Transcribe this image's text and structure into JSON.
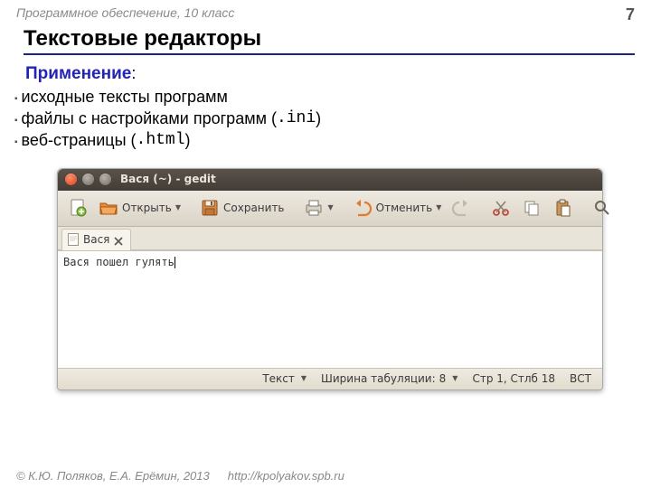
{
  "header": {
    "course": "Программное обеспечение, 10 класс",
    "page": "7"
  },
  "title": "Текстовые редакторы",
  "content": {
    "subhead": "Применение",
    "colon": ":",
    "bullets": [
      {
        "text": "исходные тексты программ",
        "suffix": ""
      },
      {
        "text": "файлы с настройками программ (",
        "mono": ".ini",
        "suffix": ")"
      },
      {
        "text": "веб-страницы (",
        "mono": ".html",
        "suffix": ")"
      }
    ]
  },
  "gedit": {
    "window_title": "Вася (~) - gedit",
    "toolbar": {
      "open": "Открыть",
      "save": "Сохранить",
      "undo": "Отменить"
    },
    "tab": {
      "name": "Вася"
    },
    "editor_text": "Вася пошел гулять",
    "status": {
      "syntax": "Текст",
      "tabwidth_label": "Ширина табуляции:",
      "tabwidth_value": "8",
      "position": "Стр 1, Стлб 18",
      "ins": "ВСТ"
    }
  },
  "footer": {
    "copyright": "© К.Ю. Поляков, Е.А. Ерёмин, 2013",
    "url": "http://kpolyakov.spb.ru"
  }
}
